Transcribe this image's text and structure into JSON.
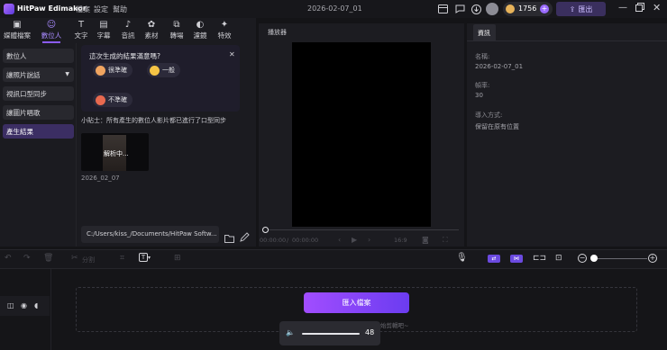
{
  "titlebar": {
    "app_name": "HitPaw Edimakor",
    "menu": [
      "檔案",
      "設定",
      "幫助"
    ],
    "project_name": "2026-02-07_01",
    "credits": "1756",
    "export_label": "匯出"
  },
  "toolbar": {
    "tools": [
      {
        "label": "媒體檔案",
        "icon": "media-icon"
      },
      {
        "label": "數位人",
        "icon": "digital-human-icon"
      },
      {
        "label": "文字",
        "icon": "text-icon"
      },
      {
        "label": "字幕",
        "icon": "subtitle-icon"
      },
      {
        "label": "音訊",
        "icon": "audio-icon"
      },
      {
        "label": "素材",
        "icon": "assets-icon"
      },
      {
        "label": "轉場",
        "icon": "transition-icon"
      },
      {
        "label": "濾鏡",
        "icon": "filter-icon"
      },
      {
        "label": "特效",
        "icon": "effects-icon"
      }
    ]
  },
  "leftnav": {
    "items": [
      "數位人",
      "讓照片說話",
      "視訊口型同步",
      "讓圖片唱歌",
      "產生結果"
    ]
  },
  "feedback": {
    "question": "這次生成的結果滿意嗎?",
    "options": [
      "很準確",
      "一般",
      "不準確"
    ]
  },
  "tip": "小貼士：所有產生的數位人影片都已進行了口型同步",
  "result": {
    "overlay": "解析中...",
    "name": "2026_02_07"
  },
  "path_field": {
    "value": "C:/Users/kiss_/Documents/HitPaw Softw..."
  },
  "player": {
    "title": "播放器",
    "time_current": "00:00:00",
    "time_total": "00:00:00",
    "aspect": "16:9"
  },
  "info": {
    "tab": "資訊",
    "name_label": "名稱:",
    "name_value": "2026-02-07_01",
    "fps_label": "幀率:",
    "fps_value": "30",
    "import_label": "導入方式:",
    "import_value": "保留在原有位置"
  },
  "timeline_toolbar": {
    "split_label": "分割"
  },
  "timeline": {
    "import_button": "匯入檔案",
    "hint_partial": "始剪輯吧~",
    "volume_value": "48"
  },
  "colors": {
    "accent": "#8b5cf6",
    "button_gradient_start": "#9b4dff",
    "button_gradient_end": "#6a3cf0"
  }
}
